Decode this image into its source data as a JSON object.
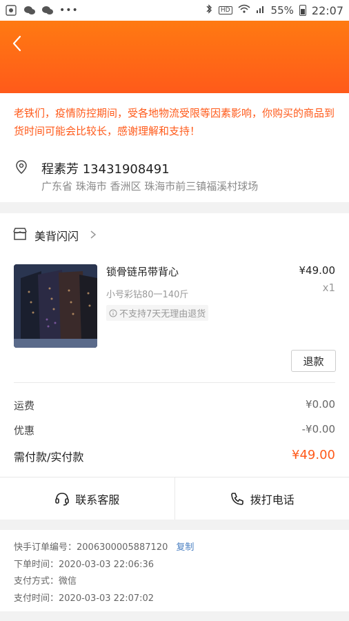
{
  "status_bar": {
    "battery": "55%",
    "time": "22:07",
    "hd": "HD"
  },
  "header": {
    "back_icon": "chevron-left-icon",
    "bg_color_top": "#ff7a12",
    "bg_color_bottom": "#ff5a1a"
  },
  "notice": {
    "text": "老铁们，疫情防控期间，受各地物流受限等因素影响，你购买的商品到货时间可能会比较长，感谢理解和支持！"
  },
  "address": {
    "name_phone": "程素芳 13431908491",
    "full_address": "广东省 珠海市 香洲区 珠海市前三镇福溪村球场"
  },
  "store": {
    "name": "美背闪闪",
    "icon": "shop-icon"
  },
  "product": {
    "title": "锁骨链吊带背心",
    "spec": "小号彩钻80一140斤",
    "no_return": "不支持7天无理由退货",
    "price": "¥49.00",
    "qty": "x1",
    "refund_label": "退款"
  },
  "fees": [
    {
      "label": "运费",
      "value": "¥0.00"
    },
    {
      "label": "优惠",
      "value": "-¥0.00"
    }
  ],
  "total": {
    "label": "需付款/实付款",
    "value": "¥49.00"
  },
  "actions": {
    "service_label": "联系客服",
    "call_label": "拨打电话"
  },
  "order_info": {
    "order_no": "快手订单编号：2006300005887120",
    "copy_label": "复制",
    "created": "下单时间：2020-03-03 22:06:36",
    "pay_method": "支付方式：微信",
    "pay_time": "支付时间：2020-03-03 22:07:02"
  },
  "colors": {
    "accent": "#ff5a1a",
    "link": "#4a7fc1"
  }
}
